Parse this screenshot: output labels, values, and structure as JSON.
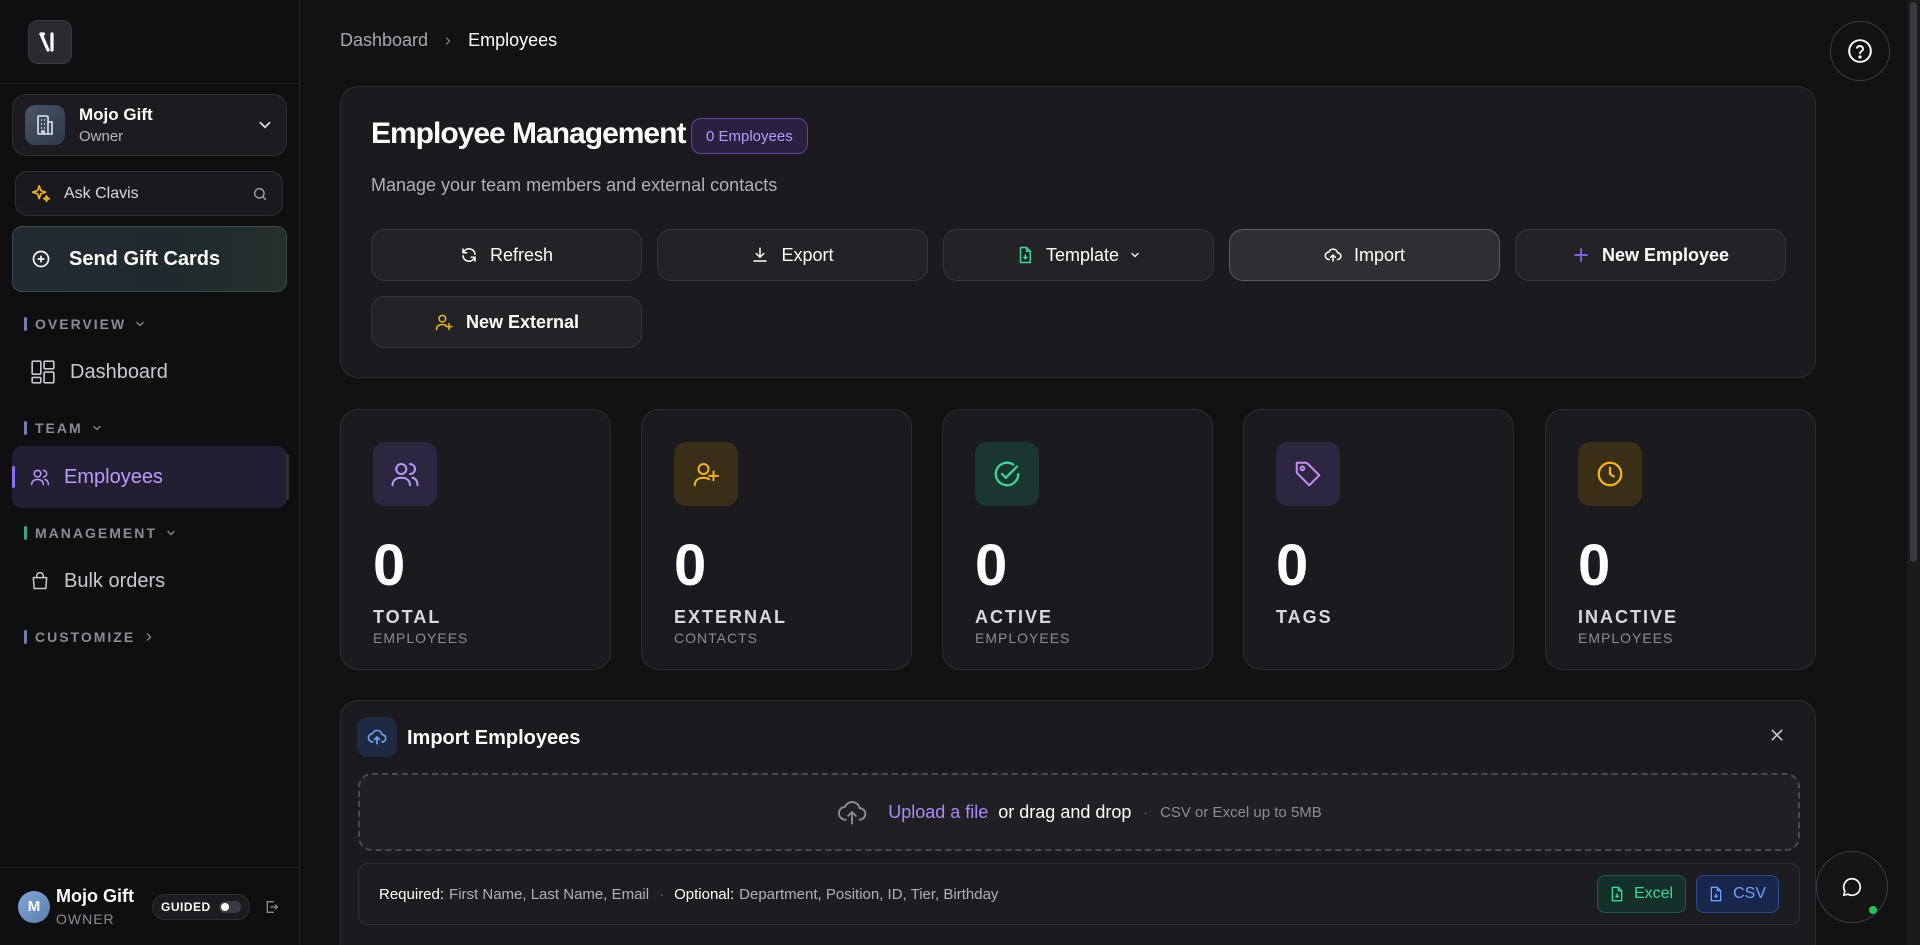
{
  "sidebar": {
    "logo_text": "M",
    "org": {
      "name": "Mojo Gift",
      "role": "Owner"
    },
    "ask": {
      "label": "Ask Clavis"
    },
    "send_button": "Send Gift Cards",
    "sections": [
      {
        "label": "OVERVIEW",
        "color": "#6b7fa8"
      },
      {
        "label": "TEAM",
        "color": "#6b7fa8"
      },
      {
        "label": "MANAGEMENT",
        "color": "#3ba57c"
      },
      {
        "label": "CUSTOMIZE",
        "color": "#6b7fa8"
      }
    ],
    "items": {
      "dashboard": "Dashboard",
      "employees": "Employees",
      "bulk_orders": "Bulk orders"
    },
    "footer": {
      "avatar_letter": "M",
      "name": "Mojo Gift",
      "role": "OWNER",
      "guided": "GUIDED"
    }
  },
  "breadcrumb": {
    "parent": "Dashboard",
    "current": "Employees"
  },
  "panel": {
    "title": "Employee Management",
    "badge": "0 Employees",
    "subtitle": "Manage your team members and external contacts",
    "actions": {
      "refresh": "Refresh",
      "export": "Export",
      "template": "Template",
      "import": "Import",
      "new_employee": "New Employee",
      "new_external": "New External"
    }
  },
  "stats": [
    {
      "value": "0",
      "label": "TOTAL",
      "sub": "EMPLOYEES",
      "icon": "users-icon"
    },
    {
      "value": "0",
      "label": "EXTERNAL",
      "sub": "CONTACTS",
      "icon": "user-plus-icon"
    },
    {
      "value": "0",
      "label": "ACTIVE",
      "sub": "EMPLOYEES",
      "icon": "check-circle-icon"
    },
    {
      "value": "0",
      "label": "TAGS",
      "sub": "",
      "icon": "tag-icon"
    },
    {
      "value": "0",
      "label": "INACTIVE",
      "sub": "EMPLOYEES",
      "icon": "clock-icon"
    }
  ],
  "import": {
    "title": "Import Employees",
    "upload_link": "Upload a file",
    "drag_text": "or drag and drop",
    "dot": "·",
    "hint": "CSV or Excel up to 5MB",
    "required_label": "Required:",
    "required_fields": "First Name, Last Name, Email",
    "optional_label": "Optional:",
    "optional_fields": "Department, Position, ID, Tier, Birthday",
    "excel": "Excel",
    "csv": "CSV"
  },
  "colors": {
    "accent_purple": "#8b6cf6",
    "accent_green": "#3ed6a0",
    "accent_amber": "#f5b324",
    "accent_blue": "#6ea0ff"
  }
}
